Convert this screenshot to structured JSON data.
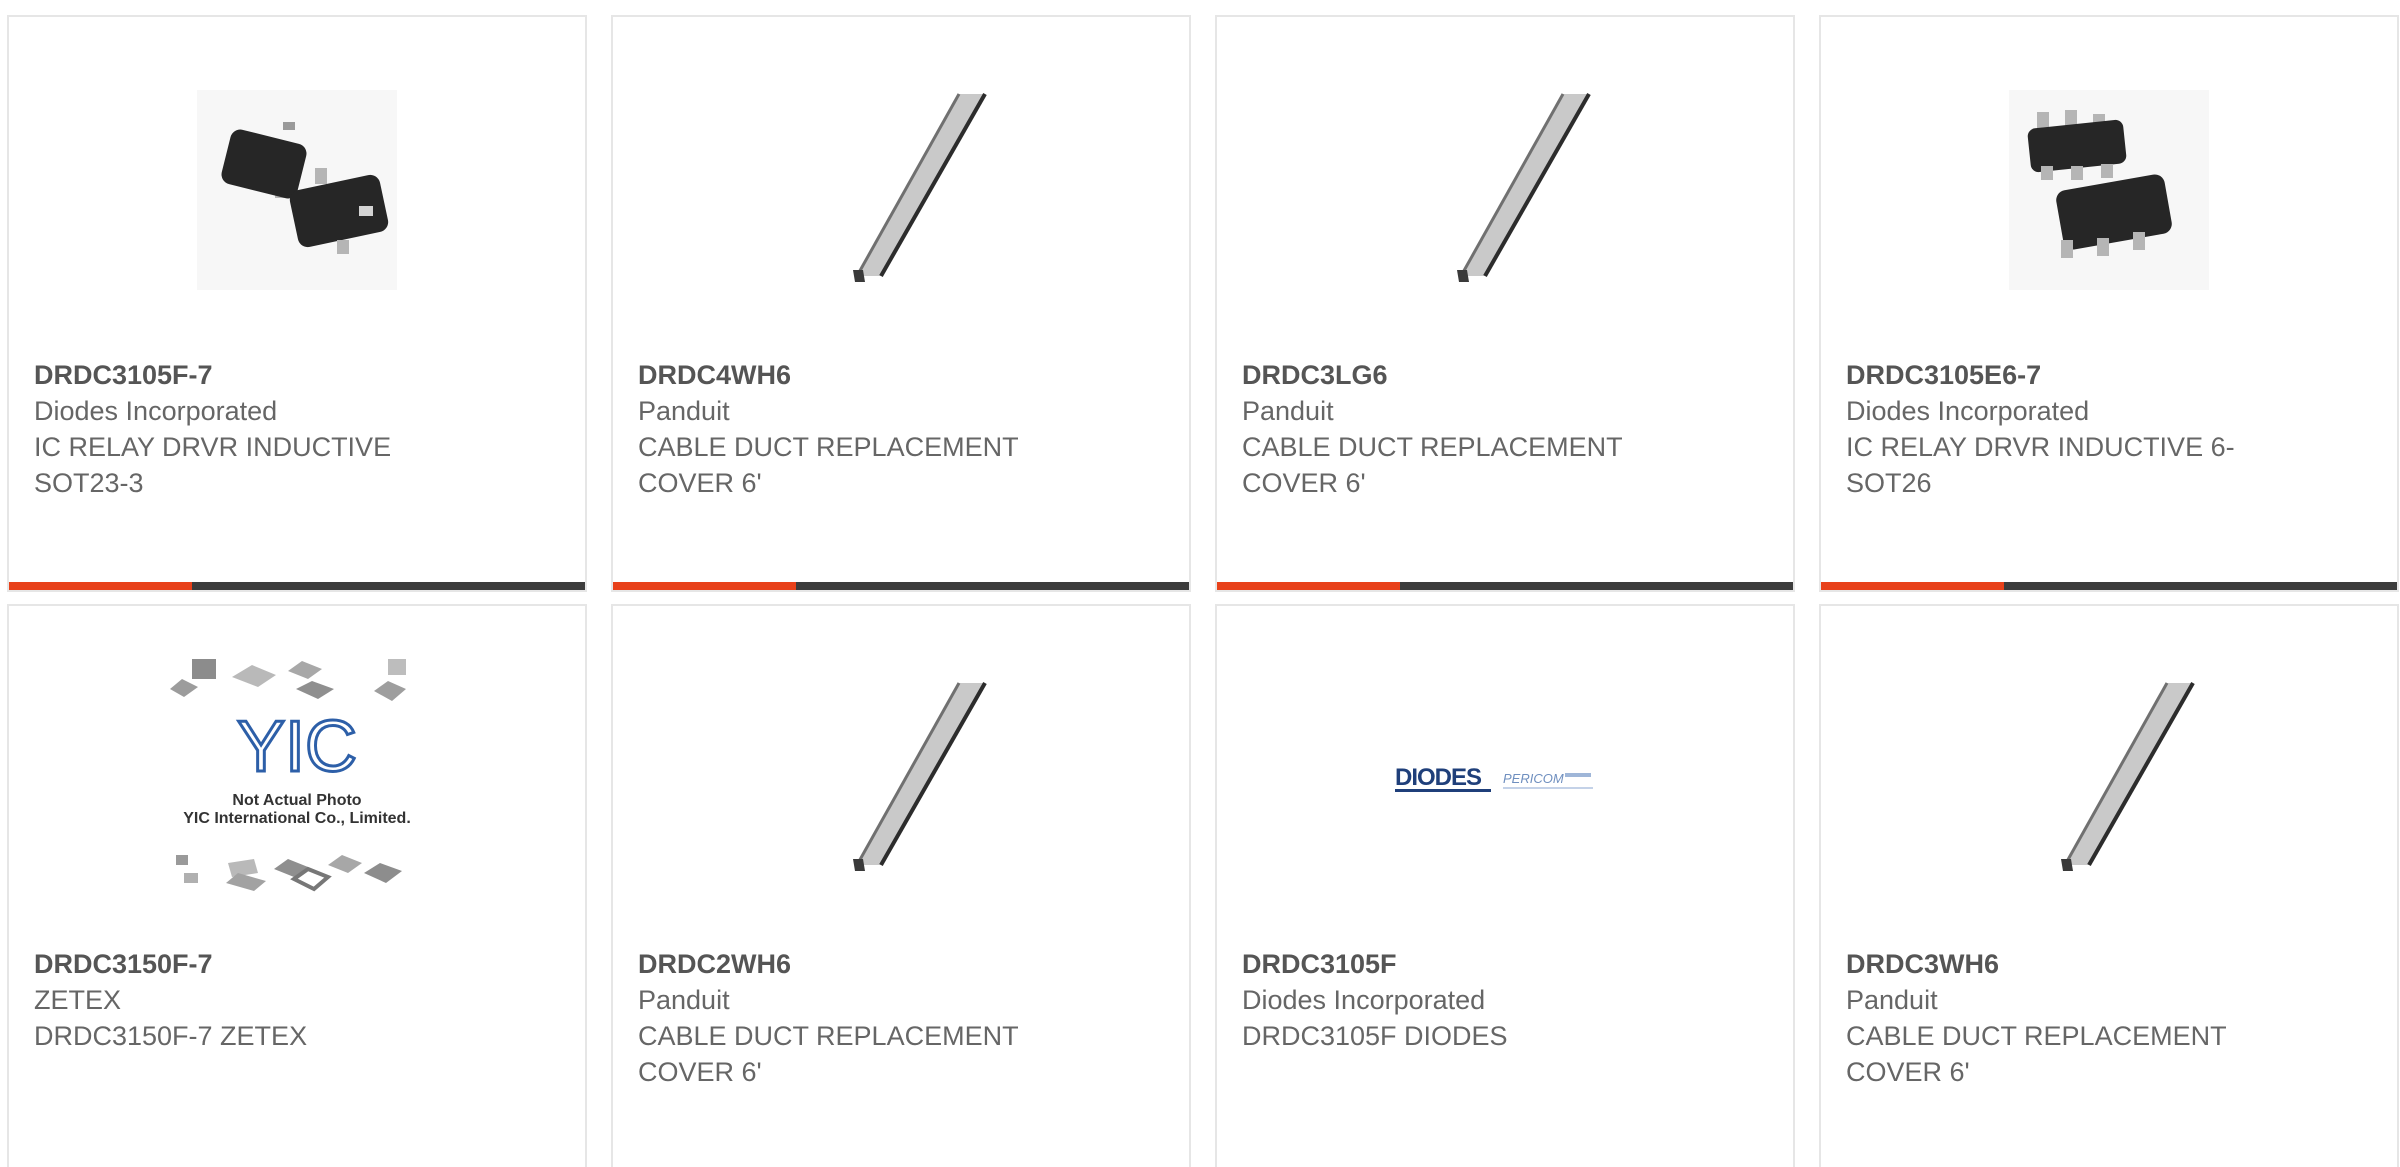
{
  "products": [
    {
      "part": "DRDC3105F-7",
      "manufacturer": "Diodes Incorporated",
      "description": "IC RELAY DRVR INDUCTIVE SOT23-3",
      "image_icon": "sot23-chip-icon",
      "accent_bar": true
    },
    {
      "part": "DRDC4WH6",
      "manufacturer": "Panduit",
      "description": "CABLE DUCT REPLACEMENT COVER 6'",
      "image_icon": "cable-duct-cover-icon",
      "accent_bar": true
    },
    {
      "part": "DRDC3LG6",
      "manufacturer": "Panduit",
      "description": "CABLE DUCT REPLACEMENT COVER 6'",
      "image_icon": "cable-duct-cover-icon",
      "accent_bar": true
    },
    {
      "part": "DRDC3105E6-7",
      "manufacturer": "Diodes Incorporated",
      "description": "IC RELAY DRVR INDUCTIVE 6-SOT26",
      "image_icon": "sot26-chip-icon",
      "accent_bar": true
    },
    {
      "part": "DRDC3150F-7",
      "manufacturer": "ZETEX",
      "description": "DRDC3150F-7 ZETEX",
      "image_icon": "placeholder-photo-icon",
      "image_caption_line1": "Not Actual Photo",
      "image_caption_line2": "YIC International Co., Limited.",
      "image_logo_text": "YIC",
      "accent_bar": false
    },
    {
      "part": "DRDC2WH6",
      "manufacturer": "Panduit",
      "description": "CABLE DUCT REPLACEMENT COVER 6'",
      "image_icon": "cable-duct-cover-icon",
      "accent_bar": false
    },
    {
      "part": "DRDC3105F",
      "manufacturer": "Diodes Incorporated",
      "description": "DRDC3105F DIODES",
      "image_icon": "diodes-logo-icon",
      "image_logo_text": "DIODES",
      "image_logo_text2": "PERICOM",
      "accent_bar": false
    },
    {
      "part": "DRDC3WH6",
      "manufacturer": "Panduit",
      "description": "CABLE DUCT REPLACEMENT COVER 6'",
      "image_icon": "cable-duct-cover-icon",
      "accent_bar": false
    }
  ],
  "colors": {
    "accent": "#e8411a",
    "bar_dark": "#3c3c3c",
    "text": "#666666",
    "border": "#e6e6e6"
  }
}
